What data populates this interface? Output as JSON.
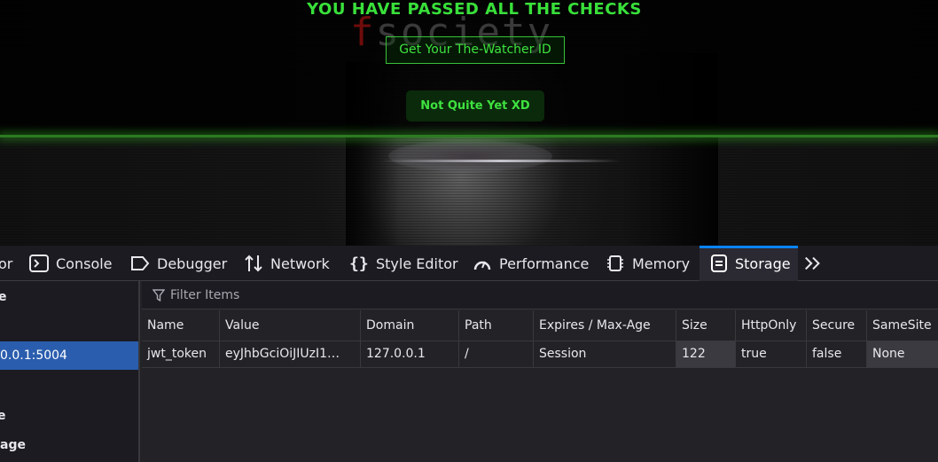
{
  "page": {
    "title": "YOU HAVE PASSED ALL THE CHECKS",
    "logo_first": "f",
    "logo_rest": "society",
    "watcher_button": "Get Your The-Watcher ID",
    "not_yet_button": "Not Quite Yet XD"
  },
  "devtools": {
    "tabs": [
      {
        "label": "or",
        "icon": "inspector-icon"
      },
      {
        "label": "Console",
        "icon": "console-icon"
      },
      {
        "label": "Debugger",
        "icon": "debugger-icon"
      },
      {
        "label": "Network",
        "icon": "network-icon"
      },
      {
        "label": "Style Editor",
        "icon": "style-editor-icon"
      },
      {
        "label": "Performance",
        "icon": "performance-icon"
      },
      {
        "label": "Memory",
        "icon": "memory-icon"
      },
      {
        "label": "Storage",
        "icon": "storage-icon",
        "selected": true
      },
      {
        "label": "",
        "icon": "more-tabs-icon"
      }
    ],
    "sidebar": {
      "items": [
        {
          "label": "e"
        },
        {
          "label": "0.0.1:5004",
          "selected": true
        },
        {
          "label": "e"
        },
        {
          "label": "age"
        }
      ]
    },
    "filter": {
      "placeholder": "Filter Items"
    },
    "columns": [
      "Name",
      "Value",
      "Domain",
      "Path",
      "Expires / Max-Age",
      "Size",
      "HttpOnly",
      "Secure",
      "SameSite"
    ],
    "rows": [
      {
        "name": "jwt_token",
        "value": "eyJhbGciOiJIUzI1…",
        "domain": "127.0.0.1",
        "path": "/",
        "expires": "Session",
        "size": "122",
        "httponly": "true",
        "secure": "false",
        "samesite": "None"
      }
    ],
    "accent_color": "#0a84ff",
    "selection_color": "#2a5dae"
  }
}
